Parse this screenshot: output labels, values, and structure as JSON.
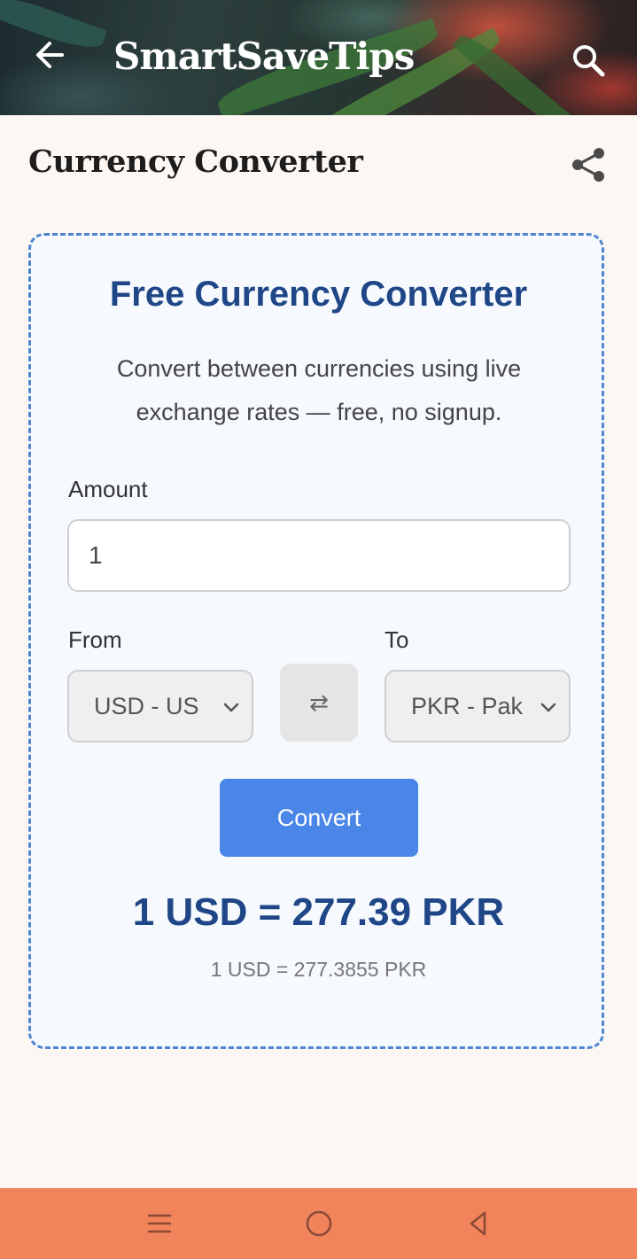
{
  "app_bar": {
    "brand": "SmartSaveTips",
    "icons": {
      "back": "back-arrow-icon",
      "search": "search-icon"
    }
  },
  "page": {
    "title": "Currency Converter",
    "share_icon": "share-icon"
  },
  "converter": {
    "title": "Free Currency Converter",
    "description": "Convert between currencies using live exchange rates — free, no signup.",
    "amount_label": "Amount",
    "amount_value": "1",
    "from_label": "From",
    "from_value": "USD - US",
    "to_label": "To",
    "to_value": "PKR - Pak",
    "swap_symbol": "⇄",
    "convert_label": "Convert",
    "result_main": "1 USD = 277.39 PKR",
    "result_detail": "1 USD = 277.3855 PKR"
  },
  "system_nav": {
    "icons": [
      "menu-icon",
      "home-circle-icon",
      "back-triangle-icon"
    ]
  },
  "colors": {
    "accent": "#4a86e8",
    "title_blue": "#1f4687",
    "nav_bar": "#f2845c",
    "card_border": "#4f86cf"
  }
}
